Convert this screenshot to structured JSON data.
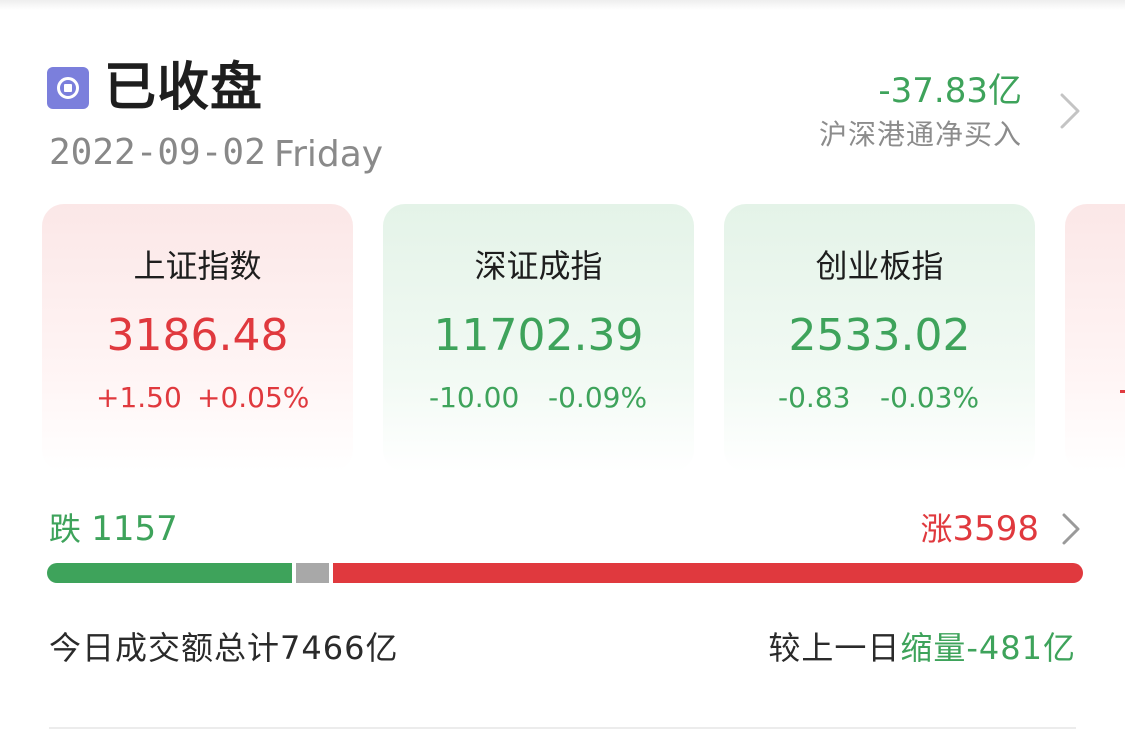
{
  "header": {
    "status_title": "已收盘",
    "date": "2022-09-02",
    "weekday": "Friday",
    "net_flow_value": "-37.83亿",
    "net_flow_label": "沪深港通净买入"
  },
  "indices": [
    {
      "name": "上证指数",
      "price": "3186.48",
      "change": "+1.50",
      "change_pct": "+0.05%",
      "direction": "up"
    },
    {
      "name": "深证成指",
      "price": "11702.39",
      "change": "-10.00",
      "change_pct": "-0.09%",
      "direction": "down"
    },
    {
      "name": "创业板指",
      "price": "2533.02",
      "change": "-0.83",
      "change_pct": "-0.03%",
      "direction": "down"
    }
  ],
  "breadth": {
    "fall_label": "跌",
    "fall_count": "1157",
    "rise_label": "涨",
    "rise_count": "3598",
    "fall_share": 0.238,
    "flat_share": 0.032,
    "rise_share": 0.73
  },
  "turnover": {
    "total_text": "今日成交额总计7466亿",
    "compare_lead": "较上一日",
    "compare_trend": "缩量-481亿"
  },
  "colors": {
    "up": "#e0393e",
    "down": "#3ea35b",
    "flat": "#a8a8a8",
    "status_icon": "#7b7fdc"
  },
  "icons": {
    "status": "stop-circle-icon",
    "chevron": "chevron-right-icon"
  }
}
